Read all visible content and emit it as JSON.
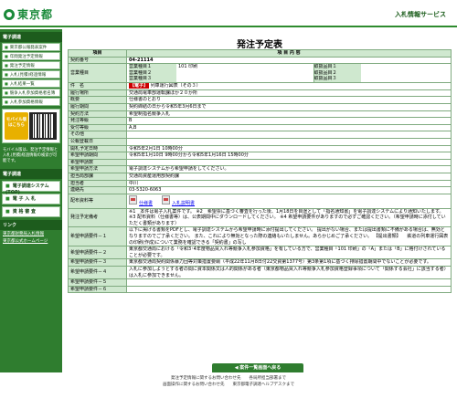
{
  "header": {
    "logo_text": "東京都",
    "service_title": "入札情報サービス"
  },
  "sidebar": {
    "section1_title": "電子調達",
    "items": [
      "東京都公報発表案件",
      "年間発注予定情報",
      "発注予定情報",
      "入札(見積)経過情報",
      "入札結果一覧",
      "競争入札参加資格者名簿",
      "入札参加資格情報"
    ],
    "mobile_label": "モバイル版 はこちら",
    "mobile_note": "モバイル版は、発注予定情報と入札(見積)経過情報の検索が可能です。",
    "section2_title": "電子調達",
    "buttons": [
      "電子調達システム(TOP)",
      "電 子 入 札",
      "資 格 審 査"
    ],
    "section3_title": "リンク",
    "links": [
      "東京都財務局入札情報",
      "東京都公式ホームページ"
    ]
  },
  "main": {
    "title": "発注予定表",
    "col_item": "項目",
    "col_content": "項 目 内 容",
    "rows": {
      "contract_no_label": "契約番号",
      "contract_no": "04-21114",
      "business_type_label": "営業種目",
      "biz1_label": "営業種目１",
      "biz1_value": "101 印刷",
      "biz2_label": "営業種目２",
      "biz3_label": "営業種目３",
      "grade1_label": "取扱品目１",
      "grade2_label": "取扱品目２",
      "grade3_label": "取扱品目３",
      "name_label": "件　名",
      "name_tag": "【電子】",
      "name_value": "列車運行図表（その３）",
      "place_label": "履行場所",
      "place_value": "交通局電車部運転課ほか２０か所",
      "summary_label": "概要",
      "summary_value": "仕様書のとおり",
      "period_label": "履行期間",
      "period_value": "契約締結の日から令和5年3月6日まで",
      "method_label": "契約方法",
      "method_value": "希望制指名競争入札",
      "rank_label": "発注等級",
      "rank_value": "B",
      "recv_rank_label": "受付等級",
      "recv_rank_value": "A,B",
      "other_label": "その他",
      "notice_date_label": "公報登載日",
      "notice_date_value": "",
      "publish_label": "開札予定日時",
      "publish_value": "令和5年2月1日 10時00分",
      "apply_period_label": "希望申請期間",
      "apply_period_value": "令和5年1月10日 9時00分から令和5年1月16日 15時00分",
      "apply_count_label": "希望申請数",
      "apply_count_value": "",
      "apply_method_label": "希望申請方法",
      "apply_method_value": "電子調達システムから希望申請をしてください。",
      "dept_label": "担当局部課",
      "dept_value": "交通局資産運用部契約課",
      "person_label": "担当者",
      "person_value": "中川",
      "tel_label": "連絡先",
      "tel_value": "03-5320-6063",
      "docs_label": "配布資料等",
      "doc1": "仕様書",
      "doc2": "入札説明書",
      "remarks_label": "発注予定備考",
      "remarks_value": "※1　本件は電子入札案件です。 ※2　希望票に基づく審査を行った後、1月18日を目途として「指名通知書」を電子調達システムにより通知いたします。 ※3 配布資料（仕様書等）は、公表期間中にダウンロードしてください。 ※4 希望申請要件がありますので必ずご確認ください。（希望申請時に添付していただく書類があります）",
      "req1_label": "希望申請要件－１",
      "req1_value": "以下に掲げる書類をPDFとし、電子調達システムから希望申請時に添付提出してください。 提出がない場合、または提出書類に不備がある場合は、無効となりますのでご了承ください。 また、これにより無効となった際の連絡もいたしません。あらかじめご了承ください。 【提出書類】 　鉄道の列車運行図表の印刷(作成)について業務を確認できる「契約書」の写し",
      "req2_label": "希望申請要件－２",
      "req2_value": "東京都交通局における「令和3･4年度物品買入れ等競争入札参加資格」を有している方で、営業種目「101 印刷」の「A」または「B」に格付けされていることが必要です。",
      "req3_label": "希望申請要件－３",
      "req3_value": "東京都交通局契約関係暴力団等対策措置要綱（平成22年11月8日付22交資第1377号）第3条第1項に基づく排除措置期間中でないことが必要です。",
      "req4_label": "希望申請要件－４",
      "req4_value": "入札に参加しようとする者の間に資本関係又は人的関係がある者（東京都物品買入れ等競争入札参加資格登録事項について「関係する会社」に該当する者）は入札に参加できません。",
      "req5_label": "希望申請要件－５",
      "req5_value": "",
      "req6_label": "希望申請要件－６",
      "req6_value": ""
    },
    "back_button": "◀ 案件一覧画面へ戻る"
  },
  "footer": {
    "line1": "発注予定情報に関するお問い合わせ先　　各局所担当部署まで",
    "line2": "画面操作に関するお問い合わせ先　　東京都電子調達ヘルプデスクまで"
  },
  "colors": {
    "primary_green": "#2f7d2f",
    "label_bg": "#cfe8cf",
    "tag_red": "#cc0000"
  }
}
